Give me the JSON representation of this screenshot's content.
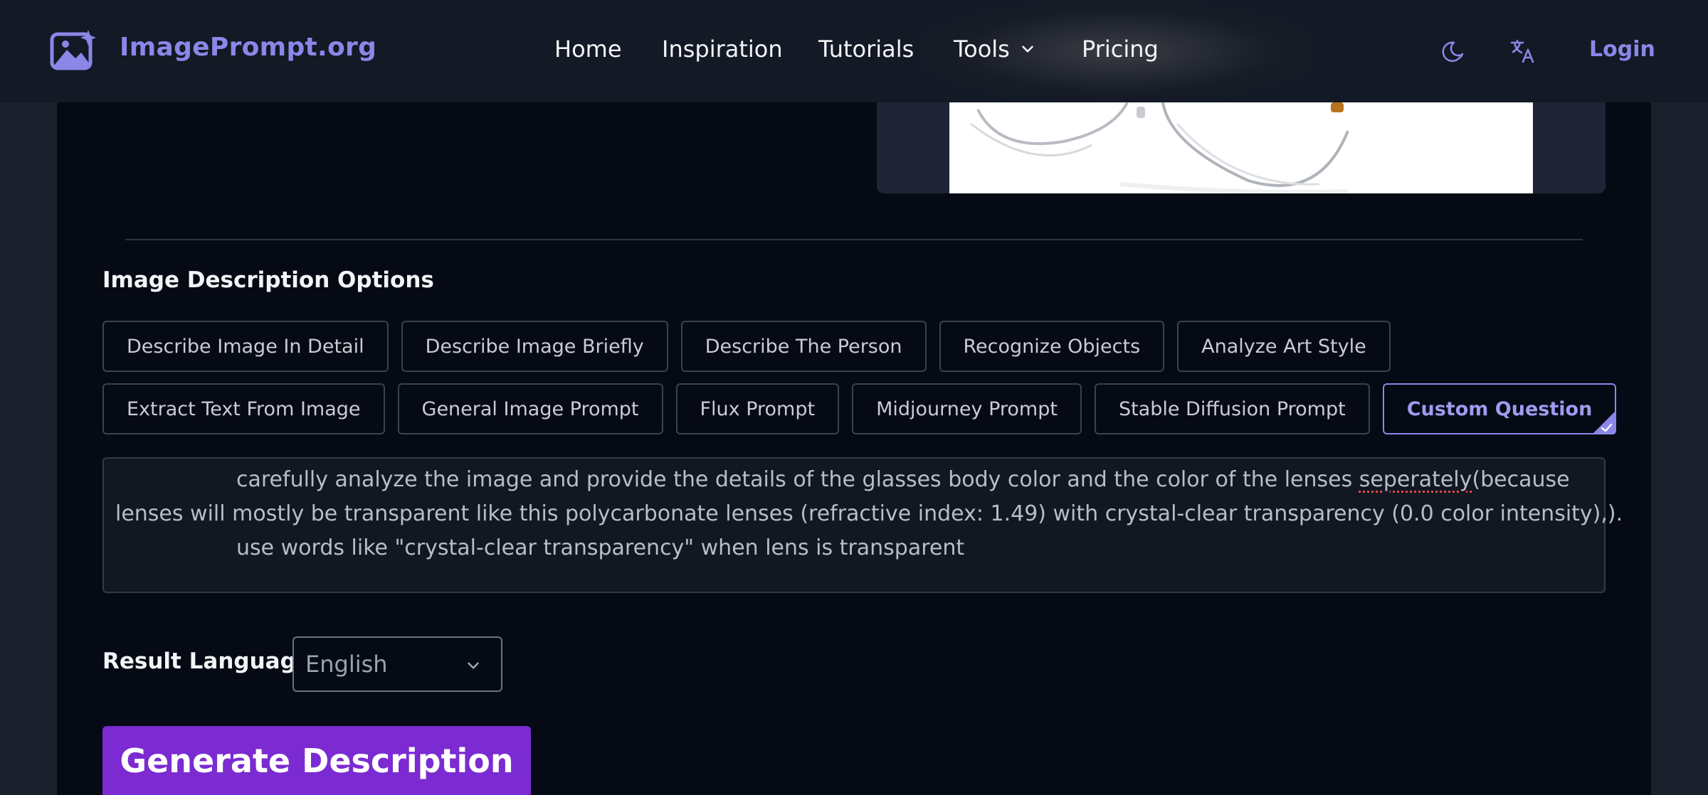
{
  "header": {
    "logo_text": "ImagePrompt.org",
    "nav": {
      "home": "Home",
      "inspiration": "Inspiration",
      "tutorials": "Tutorials",
      "tools": "Tools",
      "pricing": "Pricing"
    },
    "theme_icon": "moon-icon",
    "language_icon": "translate-icon",
    "login_label": "Login"
  },
  "options": {
    "title": "Image Description Options",
    "row1": [
      "Describe Image In Detail",
      "Describe Image Briefly",
      "Describe The Person",
      "Recognize Objects",
      "Analyze Art Style"
    ],
    "row2": [
      "Extract Text From Image",
      "General Image Prompt",
      "Flux Prompt",
      "Midjourney Prompt",
      "Stable Diffusion Prompt"
    ],
    "selected": "Custom Question"
  },
  "question": {
    "line1_before": "carefully analyze the image and provide the details of the glasses body color and the color of the lenses ",
    "line1_misspelled": "seperately",
    "line1_after": "(because",
    "line2": "lenses will mostly be transparent like this polycarbonate lenses (refractive index: 1.49) with crystal-clear transparency (0.0 color intensity),).",
    "line3": "use words like \"crystal-clear transparency\" when lens is transparent"
  },
  "language": {
    "label": "Result Language",
    "selected": "English"
  },
  "generate_label": "Generate Description",
  "colors": {
    "accent": "#8b87e8",
    "button": "#7b2bd1",
    "background": "#050a14"
  }
}
